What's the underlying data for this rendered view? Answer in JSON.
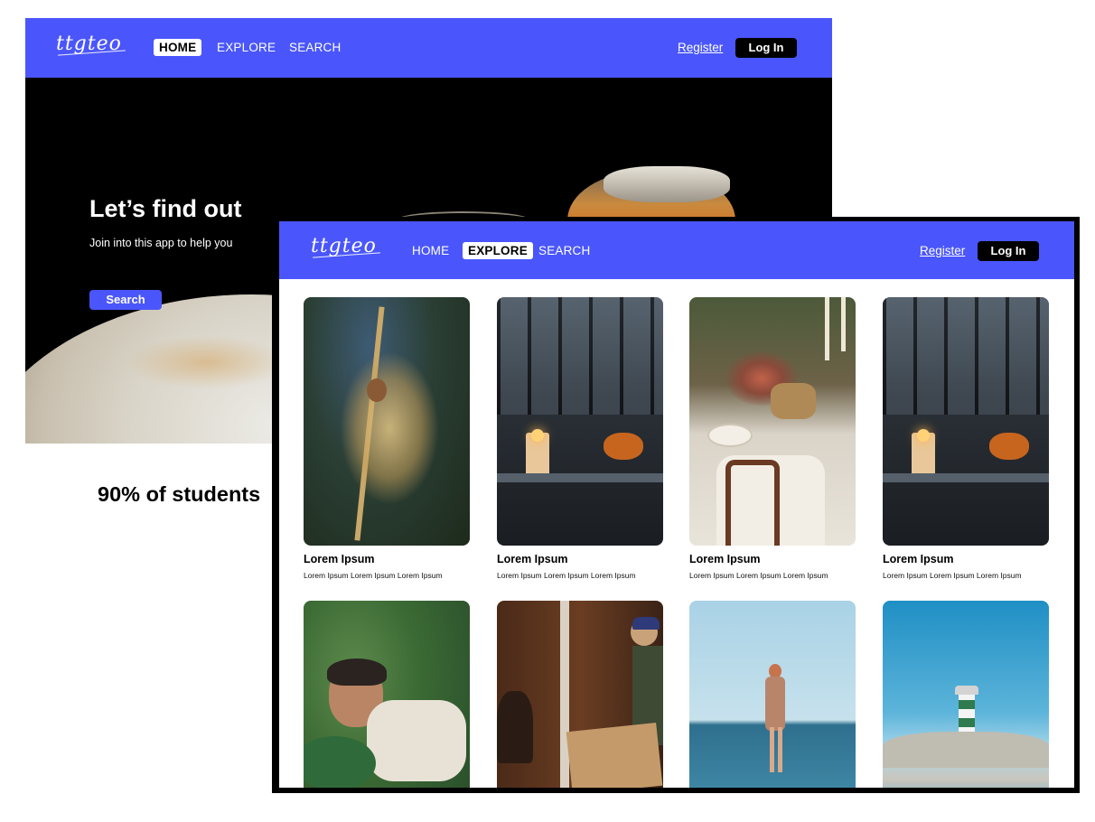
{
  "brand": {
    "logo_text": "ttgteo"
  },
  "nav": {
    "items": [
      {
        "label": "HOME"
      },
      {
        "label": "EXPLORE"
      },
      {
        "label": "SEARCH"
      }
    ],
    "register_label": "Register",
    "login_label": "Log In"
  },
  "home_page": {
    "active_tab": "HOME",
    "hero": {
      "title": "Let’s find out",
      "subtitle": "Join into this app to help you",
      "button_label": "Search"
    },
    "stat_heading": "90% of students"
  },
  "explore_page": {
    "active_tab": "EXPLORE",
    "cards": [
      {
        "title": "Lorem Ipsum",
        "description": "Lorem Ipsum Lorem Ipsum Lorem Ipsum",
        "image": "oat-grass-with-mouse"
      },
      {
        "title": "Lorem Ipsum",
        "description": "Lorem Ipsum Lorem Ipsum Lorem Ipsum",
        "image": "candles-and-pumpkin"
      },
      {
        "title": "Lorem Ipsum",
        "description": "Lorem Ipsum Lorem Ipsum Lorem Ipsum",
        "image": "autumn-table-setting"
      },
      {
        "title": "Lorem Ipsum",
        "description": "Lorem Ipsum Lorem Ipsum Lorem Ipsum",
        "image": "candles-and-pumpkin"
      },
      {
        "title": "",
        "description": "",
        "image": "person-in-leaves"
      },
      {
        "title": "",
        "description": "",
        "image": "moving-boxes"
      },
      {
        "title": "",
        "description": "",
        "image": "woman-at-sea"
      },
      {
        "title": "",
        "description": "",
        "image": "lighthouse"
      }
    ]
  },
  "colors": {
    "nav_bg": "#4a56fb",
    "button_bg": "#000000",
    "accent": "#4a56fb",
    "text": "#000000"
  }
}
